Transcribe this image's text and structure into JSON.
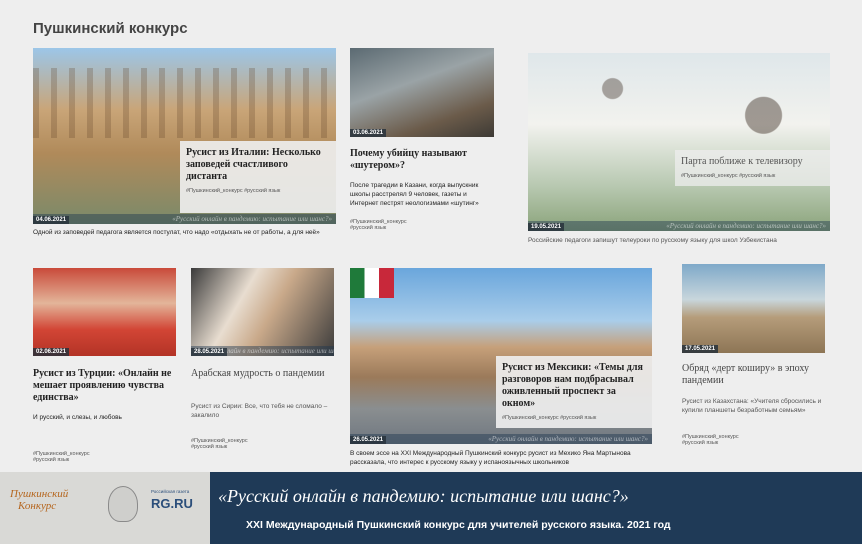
{
  "section_title": "Пушкинский конкурс",
  "strip_text": "«Русский онлайн в пандемию: испытание или шанс?»",
  "cards": [
    {
      "date": "04.06.2021",
      "title": "Русист из Италии: Несколько заповедей счастливого дистанта",
      "tags": "#Пушкинский_конкурс #русский язык",
      "desc": "Одной из заповедей педагога является постулат, что надо «отдыхать не от работы, а для неё»"
    },
    {
      "date": "03.06.2021",
      "title": "Почему убийцу называют «шутером»?",
      "desc": "После трагедии в Казани, когда выпускник школы расстрелял 9 человек, газеты и Интернет пестрят неологизмами «шутинг»",
      "tags": "#Пушкинский_конкурс #русский язык"
    },
    {
      "date": "19.05.2021",
      "title": "Парта поближе к телевизору",
      "tags": "#Пушкинский_конкурс #русский язык",
      "desc": "Российские педагоги запишут телеуроки по русскому языку для школ Узбекистана"
    },
    {
      "date": "02.06.2021",
      "title": "Русист из Турции: «Онлайн не мешает проявлению чувства единства»",
      "desc": "И русский, и слезы, и любовь",
      "tags": "#Пушкинский_конкурс #русский язык"
    },
    {
      "date": "28.05.2021",
      "title": "Арабская мудрость о пандемии",
      "desc": "Русист из Сирии: Все, что тебя не сломало – закалило",
      "tags": "#Пушкинский_конкурс #русский язык"
    },
    {
      "date": "26.05.2021",
      "title": "Русист из Мексики: «Темы для разговоров нам подбрасывал оживленный проспект за окном»",
      "tags": "#Пушкинский_конкурс #русский язык",
      "desc": "В своем эссе на XXI Международный Пушкинский конкурс русист из Мехико Яна Мартынова рассказала, что интерес к русскому языку у испаноязычных школьников"
    },
    {
      "date": "17.05.2021",
      "title": "Обряд «дерт коширу» в эпоху пандемии",
      "desc": "Русист из Казахстана: «Учителя сбросились и купили планшеты безработным семьям»",
      "tags": "#Пушкинский_конкурс #русский язык"
    }
  ],
  "banner": {
    "logo_line1": "Пушкинский",
    "logo_line2": "Конкурс",
    "rg_small": "Российская газета",
    "rg_logo": "RG.RU",
    "slogan": "«Русский онлайн в пандемию: испытание или шанс?»",
    "subslogan": "XXI Международный Пушкинский конкурс  для учителей русского языка. 2021 год"
  },
  "colors": {
    "banner_bg": "#1f3a57",
    "logo_orange": "#b5651d",
    "page_bg": "#eeeeee"
  }
}
